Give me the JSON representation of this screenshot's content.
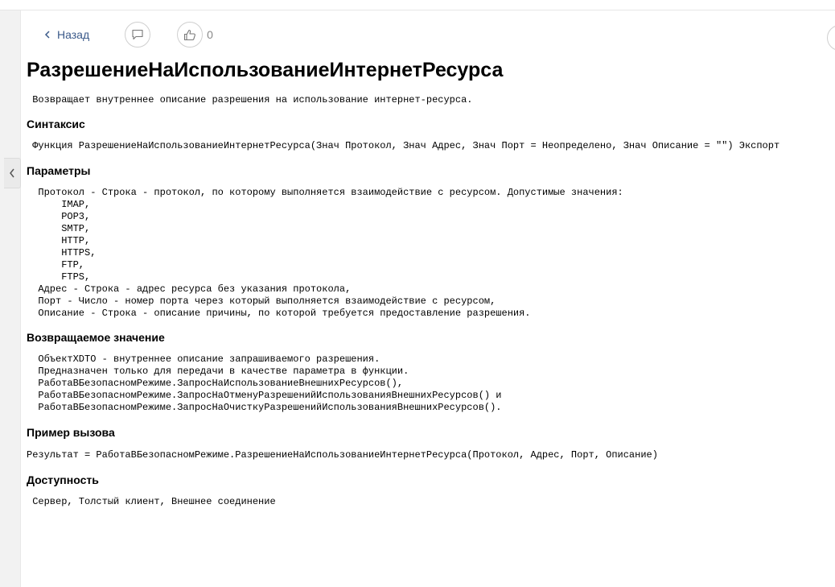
{
  "toolbar": {
    "back_label": "Назад",
    "like_count": "0"
  },
  "page": {
    "title": "РазрешениеНаИспользованиеИнтернетРесурса",
    "description": " Возвращает внутреннее описание разрешения на использование интернет-ресурса.",
    "sections": {
      "syntax": {
        "heading": "Синтаксис",
        "body": " Функция РазрешениеНаИспользованиеИнтернетРесурса(Знач Протокол, Знач Адрес, Знач Порт = Неопределено, Знач Описание = \"\") Экспорт"
      },
      "params": {
        "heading": "Параметры",
        "body": "  Протокол - Строка - протокол, по которому выполняется взаимодействие с ресурсом. Допустимые значения:\n      IMAP,\n      POP3,\n      SMTP,\n      HTTP,\n      HTTPS,\n      FTP,\n      FTPS,\n  Адрес - Строка - адрес ресурса без указания протокола,\n  Порт - Число - номер порта через который выполняется взаимодействие с ресурсом,\n  Описание - Строка - описание причины, по которой требуется предоставление разрешения."
      },
      "returns": {
        "heading": "Возвращаемое значение",
        "body": "  ОбъектXDTO - внутреннее описание запрашиваемого разрешения.\n  Предназначен только для передачи в качестве параметра в функции.\n  РаботаВБезопасномРежиме.ЗапросНаИспользованиеВнешнихРесурсов(),\n  РаботаВБезопасномРежиме.ЗапросНаОтменуРазрешенийИспользованияВнешнихРесурсов() и\n  РаботаВБезопасномРежиме.ЗапросНаОчисткуРазрешенийИспользованияВнешнихРесурсов()."
      },
      "example": {
        "heading": "Пример вызова",
        "body": "Результат = РаботаВБезопасномРежиме.РазрешениеНаИспользованиеИнтернетРесурса(Протокол, Адрес, Порт, Описание)"
      },
      "availability": {
        "heading": "Доступность",
        "body": " Сервер, Толстый клиент, Внешнее соединение"
      }
    }
  },
  "colors": {
    "link": "#3b5a8a",
    "border": "#cfcfcf",
    "sidebar": "#f2f2f2"
  },
  "icons": {
    "back": "chevron-left-icon",
    "comment": "comment-icon",
    "like": "thumbs-up-icon",
    "collapse": "chevron-left-icon"
  }
}
